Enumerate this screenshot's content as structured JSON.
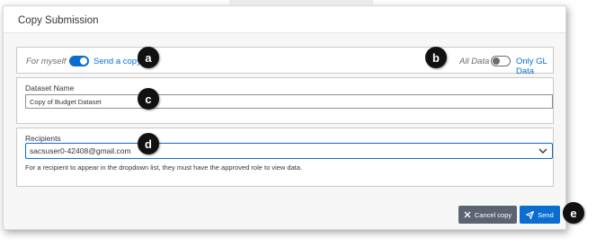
{
  "dialog": {
    "title": "Copy Submission"
  },
  "copy_mode": {
    "left_label": "For myself",
    "right_label": "Send a copy",
    "toggle_on": true
  },
  "data_scope": {
    "left_label": "All Data",
    "right_label": "Only GL Data",
    "toggle_on": false
  },
  "dataset_name": {
    "label": "Dataset Name",
    "value": "Copy of Budget Dataset"
  },
  "recipients": {
    "label": "Recipients",
    "selected": "sacsuser0-42408@gmail.com",
    "hint": "For a recipient to appear in the dropdown list, they must have the approved role to view data."
  },
  "buttons": {
    "cancel_label": "Cancel copy",
    "send_label": "Send"
  },
  "markers": {
    "a": "a",
    "b": "b",
    "c": "c",
    "d": "d",
    "e": "e"
  },
  "colors": {
    "accent": "#0a6ed1",
    "cancel_button": "#5b6470",
    "marker": "#111111"
  },
  "icons": {
    "cancel": "close-icon",
    "send": "send-icon",
    "dropdown": "chevron-down-icon"
  }
}
